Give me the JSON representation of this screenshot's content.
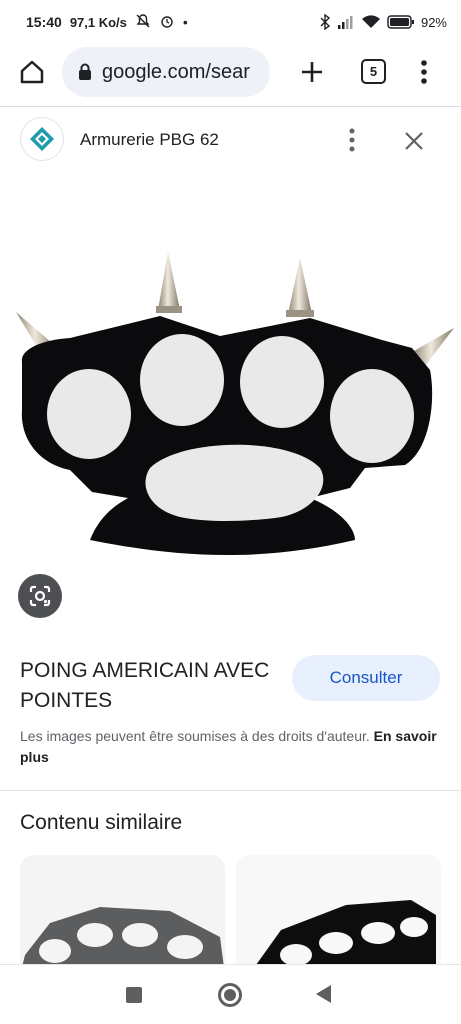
{
  "status_bar": {
    "time": "15:40",
    "speed": "97,1 Ko/s",
    "dot": "•",
    "battery": "92%"
  },
  "browser": {
    "url": "google.com/sear",
    "tab_count": "5",
    "icons": {
      "home": "home-icon",
      "lock": "lock-icon",
      "new_tab": "plus-icon",
      "menu": "more-vert-icon"
    }
  },
  "source": {
    "name": "Armurerie PBG 62",
    "logo": "diamond-logo-icon",
    "accent": "#1f9bb0"
  },
  "result": {
    "title": "POING AMERICAIN AVEC POINTES",
    "action_label": "Consulter",
    "copyright": "Les images peuvent être soumises à des droits d'auteur.",
    "learn_more": "En savoir plus"
  },
  "similar": {
    "heading": "Contenu similaire"
  },
  "colors": {
    "accent_blue": "#1a56c8",
    "pill_bg": "#eef1f8",
    "button_bg": "#e8f0fe"
  }
}
